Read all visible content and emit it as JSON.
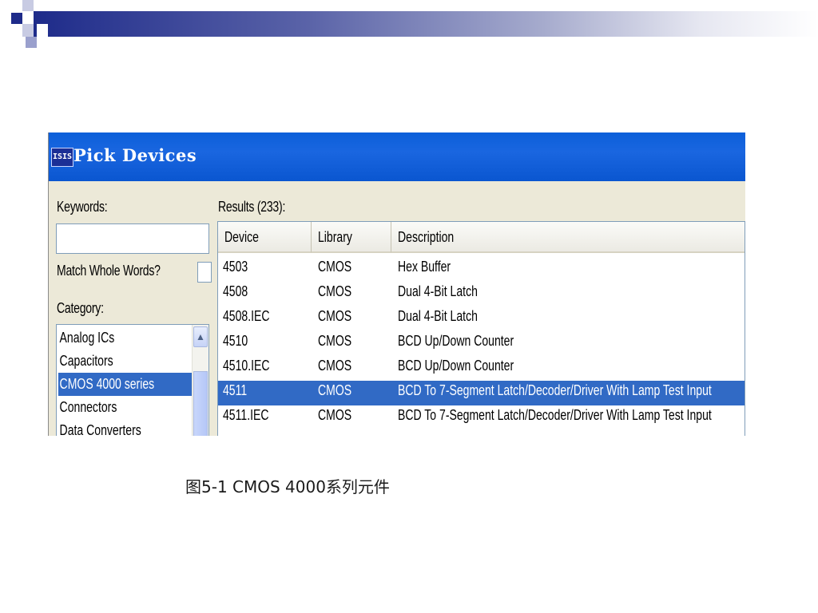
{
  "dialog": {
    "title": "Pick Devices",
    "app_icon_label": "ISIS",
    "keywords_label": "Keywords:",
    "keywords_value": "",
    "match_whole_words_label": "Match Whole Words?",
    "match_whole_words_checked": false,
    "category_label": "Category:",
    "categories": [
      {
        "label": "Analog ICs",
        "selected": false
      },
      {
        "label": "Capacitors",
        "selected": false
      },
      {
        "label": "CMOS 4000 series",
        "selected": true
      },
      {
        "label": "Connectors",
        "selected": false
      },
      {
        "label": "Data Converters",
        "selected": false
      }
    ],
    "results_label": "Results (233):",
    "columns": [
      "Device",
      "Library",
      "Description"
    ],
    "rows": [
      {
        "device": "4503",
        "library": "CMOS",
        "description": "Hex Buffer",
        "selected": false
      },
      {
        "device": "4508",
        "library": "CMOS",
        "description": "Dual 4-Bit Latch",
        "selected": false
      },
      {
        "device": "4508.IEC",
        "library": "CMOS",
        "description": "Dual 4-Bit Latch",
        "selected": false
      },
      {
        "device": "4510",
        "library": "CMOS",
        "description": "BCD Up/Down Counter",
        "selected": false
      },
      {
        "device": "4510.IEC",
        "library": "CMOS",
        "description": "BCD Up/Down Counter",
        "selected": false
      },
      {
        "device": "4511",
        "library": "CMOS",
        "description": "BCD To 7-Segment Latch/Decoder/Driver With Lamp Test Input",
        "selected": true
      },
      {
        "device": "4511.IEC",
        "library": "CMOS",
        "description": "BCD To 7-Segment Latch/Decoder/Driver With Lamp Test Input",
        "selected": false
      }
    ]
  },
  "caption": "图5-1  CMOS 4000系列元件",
  "colors": {
    "titlebar": "#0a5ad6",
    "selection": "#316ac5",
    "dialog_bg": "#ece9d8",
    "deco": "#1e2b8a"
  }
}
